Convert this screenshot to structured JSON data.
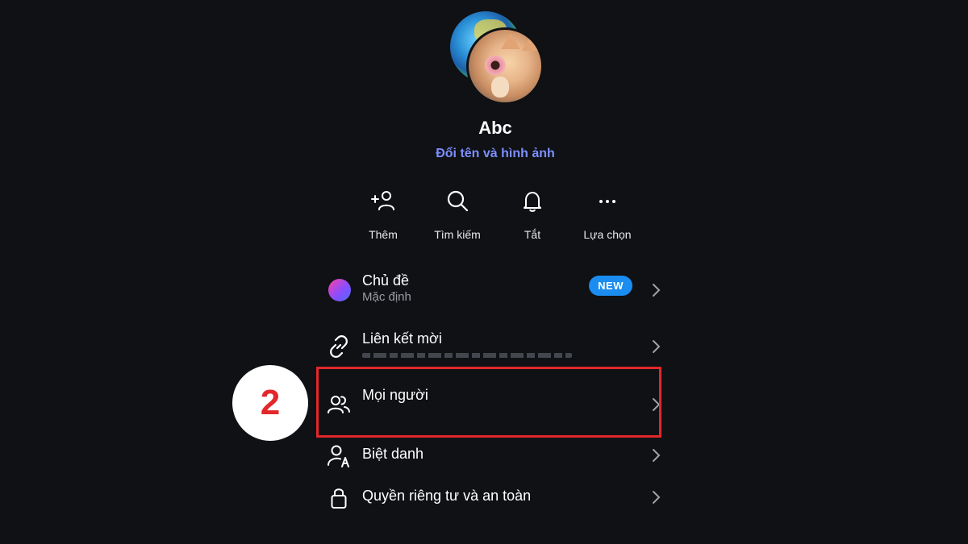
{
  "header": {
    "group_name": "Abc",
    "rename_link": "Đổi tên và hình ảnh"
  },
  "actions": [
    {
      "label": "Thêm",
      "icon": "add-person-icon"
    },
    {
      "label": "Tìm kiếm",
      "icon": "search-icon"
    },
    {
      "label": "Tắt",
      "icon": "bell-icon"
    },
    {
      "label": "Lựa chọn",
      "icon": "more-icon"
    }
  ],
  "menu": {
    "theme": {
      "title": "Chủ đề",
      "subtitle": "Mặc định",
      "badge": "NEW"
    },
    "invite_link": {
      "title": "Liên kết mời"
    },
    "people": {
      "title": "Mọi người"
    },
    "nickname": {
      "title": "Biệt danh"
    },
    "privacy": {
      "title": "Quyền riêng tư và an toàn"
    }
  },
  "annotation": {
    "step_number": "2",
    "color": "#e3272b"
  },
  "colors": {
    "background": "#0f1115",
    "accent_link": "#7c8fff",
    "badge": "#1b8cf0"
  }
}
